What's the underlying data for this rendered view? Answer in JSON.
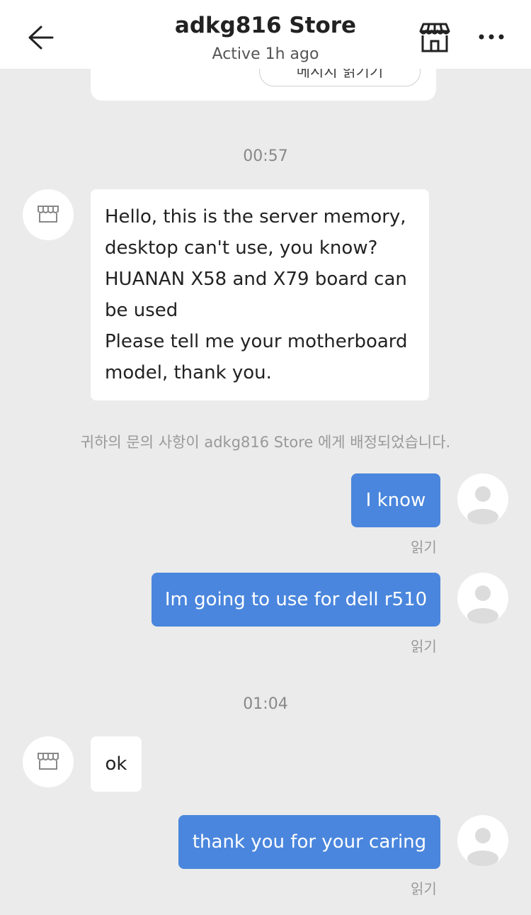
{
  "header": {
    "title": "adkg816 Store",
    "subtitle": "Active 1h ago"
  },
  "top_card": {
    "button_label": "메시지 읽기기"
  },
  "chat": {
    "time_1": "00:57",
    "msg_store_1_lines": [
      "Hello, this is the server memory,",
      "desktop can't use, you know?",
      "HUANAN X58 and X79 board can",
      "be used",
      "Please tell me your motherboard",
      "model, thank you."
    ],
    "system_note": "귀하의 문의 사항이 adkg816 Store 에게 배정되었습니다.",
    "msg_user_1": "I know",
    "read_1": "읽기",
    "msg_user_2": "Im going to use for dell r510",
    "read_2": "읽기",
    "time_2": "01:04",
    "msg_store_2": "ok",
    "msg_user_3": "thank you for your caring",
    "read_3": "읽기"
  },
  "colors": {
    "outgoing_bubble": "#4a86dd",
    "incoming_bubble": "#ffffff",
    "background": "#ebebeb"
  },
  "icons": {
    "back": "arrow-left-icon",
    "store": "storefront-icon",
    "more": "ellipsis-icon",
    "avatar_store": "store-avatar-icon",
    "avatar_user": "user-placeholder-icon"
  }
}
